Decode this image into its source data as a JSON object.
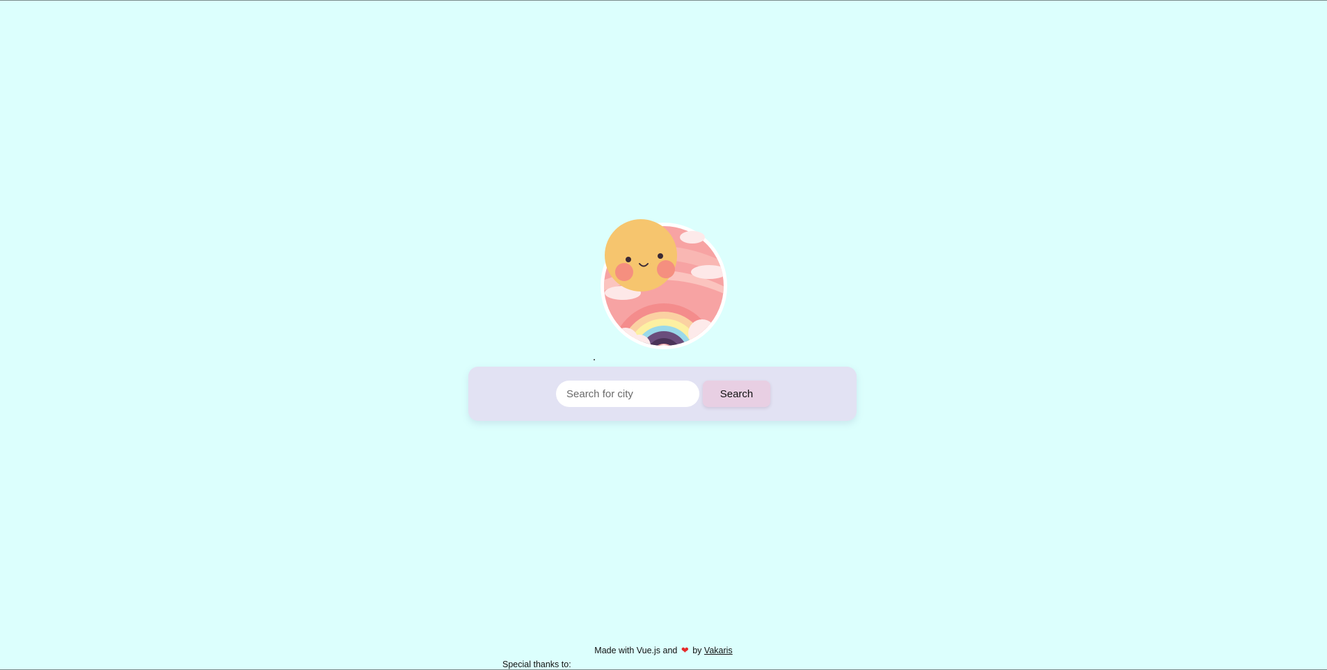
{
  "search": {
    "placeholder": "Search for city",
    "button_label": "Search"
  },
  "footer": {
    "made_with_prefix": "Made with Vue.js and",
    "heart_icon": "heart-icon",
    "by_label": "by",
    "author_link": "Vakaris",
    "special_thanks": "Special thanks to:"
  },
  "colors": {
    "background": "#dcfffd",
    "panel": "#e2e2f3",
    "button": "#e8cfe3",
    "heart": "#e52b2b"
  }
}
